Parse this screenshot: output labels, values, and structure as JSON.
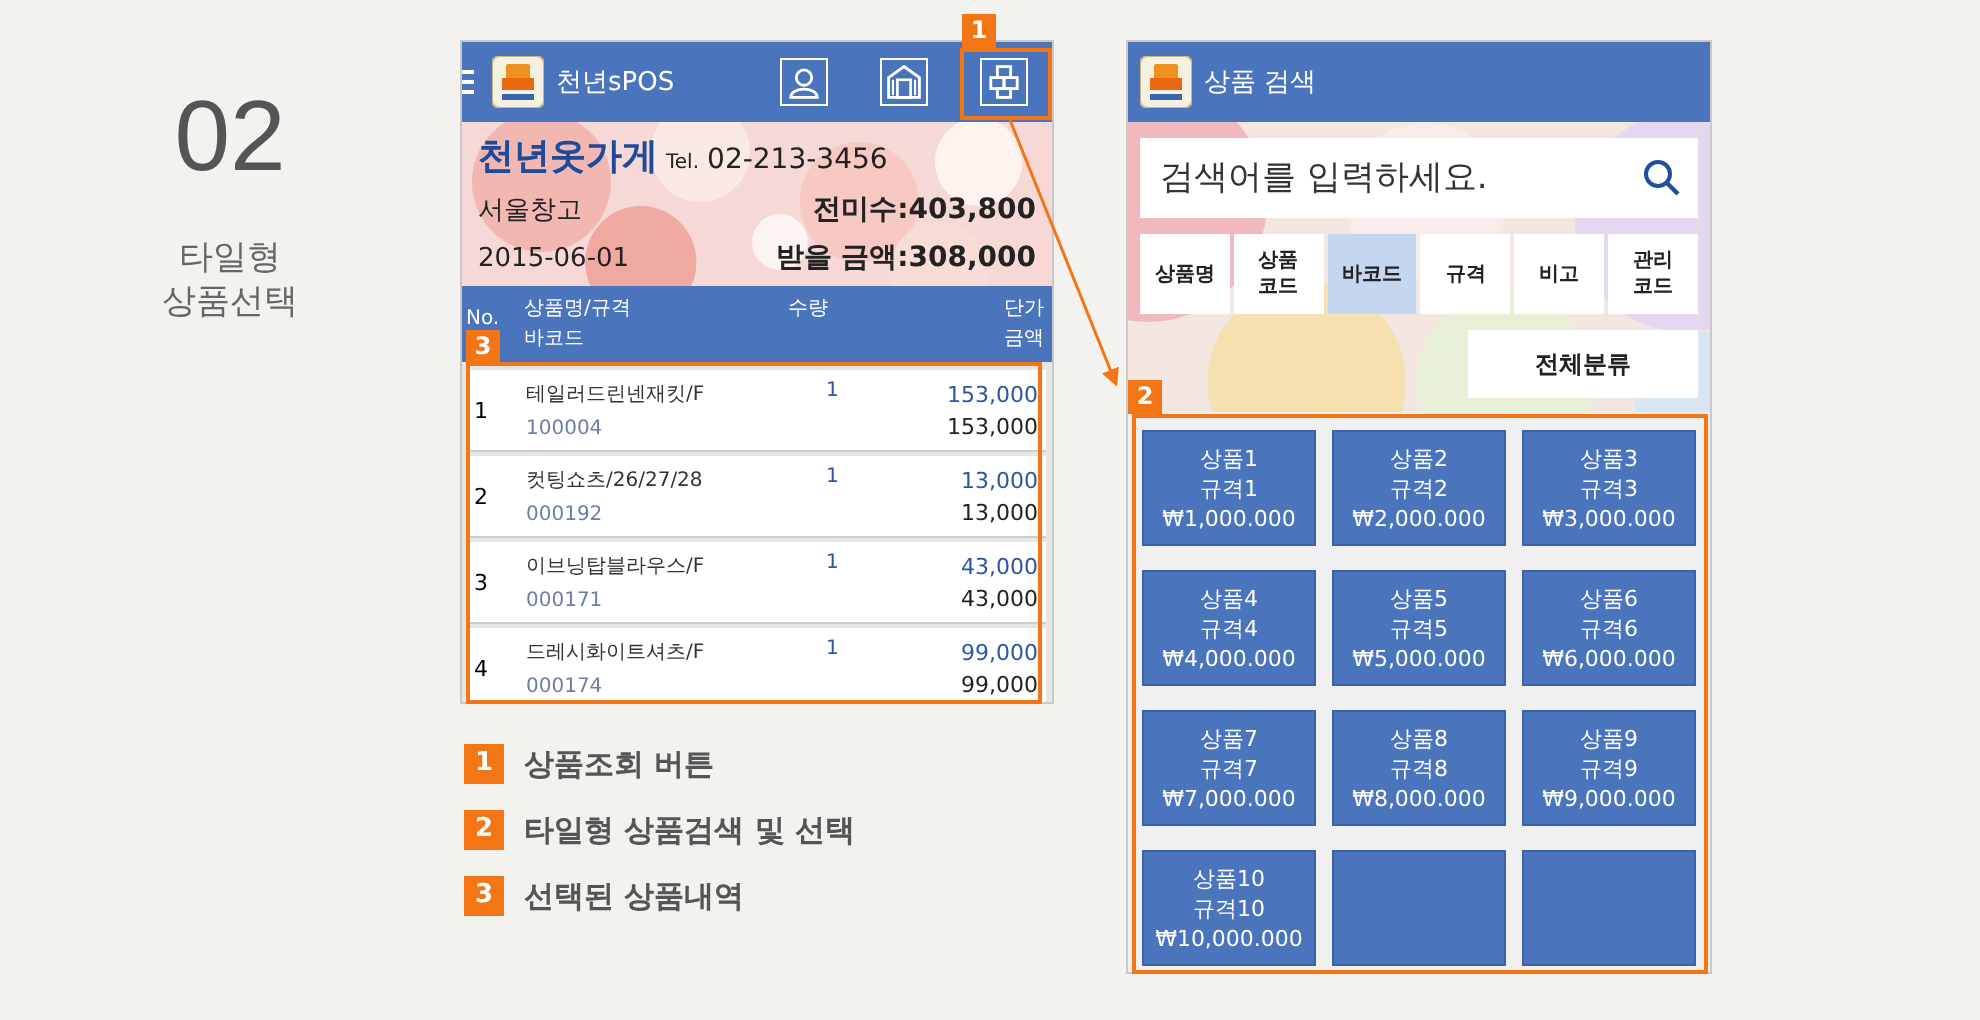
{
  "section": {
    "number": "02",
    "title_lines": [
      "타일형",
      "상품선택"
    ]
  },
  "pos_screen": {
    "app_title": "천년sPOS",
    "store_name": "천년옷가게",
    "tel_label": "Tel.",
    "tel": "02-213-3456",
    "warehouse": "서울창고",
    "balance": "전미수:403,800",
    "date": "2015-06-01",
    "receivable": "받을 금액:308,000",
    "columns": {
      "no": "No.",
      "name": "상품명/규격",
      "barcode": "바코드",
      "qty": "수량",
      "price": "단가",
      "amount": "금액"
    },
    "rows": [
      {
        "no": "1",
        "name": "테일러드린넨재킷/F",
        "barcode": "100004",
        "qty": "1",
        "price": "153,000",
        "amount": "153,000"
      },
      {
        "no": "2",
        "name": "컷팅쇼츠/26/27/28",
        "barcode": "000192",
        "qty": "1",
        "price": "13,000",
        "amount": "13,000"
      },
      {
        "no": "3",
        "name": "이브닝탑블라우스/F",
        "barcode": "000171",
        "qty": "1",
        "price": "43,000",
        "amount": "43,000"
      },
      {
        "no": "4",
        "name": "드레시화이트셔츠/F",
        "barcode": "000174",
        "qty": "1",
        "price": "99,000",
        "amount": "99,000"
      }
    ]
  },
  "search_screen": {
    "app_title": "상품 검색",
    "search": {
      "placeholder": "검색어를 입력하세요."
    },
    "filters": [
      {
        "label": "상품명",
        "selected": false
      },
      {
        "label": "상품\n코드",
        "selected": false
      },
      {
        "label": "바코드",
        "selected": true
      },
      {
        "label": "규격",
        "selected": false
      },
      {
        "label": "비고",
        "selected": false
      },
      {
        "label": "관리\n코드",
        "selected": false
      }
    ],
    "category": "전체분류",
    "tiles": [
      {
        "kind": "product",
        "name": "상품1",
        "spec": "규격1",
        "price": "₩1,000.000"
      },
      {
        "kind": "product",
        "name": "상품2",
        "spec": "규격2",
        "price": "₩2,000.000"
      },
      {
        "kind": "product",
        "name": "상품3",
        "spec": "규격3",
        "price": "₩3,000.000"
      },
      {
        "kind": "product",
        "name": "상품4",
        "spec": "규격4",
        "price": "₩4,000.000"
      },
      {
        "kind": "product",
        "name": "상품5",
        "spec": "규격5",
        "price": "₩5,000.000"
      },
      {
        "kind": "product",
        "name": "상품6",
        "spec": "규격6",
        "price": "₩6,000.000"
      },
      {
        "kind": "product",
        "name": "상품7",
        "spec": "규격7",
        "price": "₩7,000.000"
      },
      {
        "kind": "product",
        "name": "상품8",
        "spec": "규격8",
        "price": "₩8,000.000"
      },
      {
        "kind": "product",
        "name": "상품9",
        "spec": "규격9",
        "price": "₩9,000.000"
      },
      {
        "kind": "product",
        "name": "상품10",
        "spec": "규격10",
        "price": "₩10,000.000"
      },
      {
        "kind": "empty"
      },
      {
        "kind": "empty"
      }
    ]
  },
  "markers": [
    {
      "number": "1"
    },
    {
      "number": "2"
    },
    {
      "number": "3"
    }
  ],
  "legend": [
    {
      "number": "1",
      "text": "상품조회 버튼"
    },
    {
      "number": "2",
      "text": "타일형 상품검색 및 선택"
    },
    {
      "number": "3",
      "text": "선택된 상품내역"
    }
  ]
}
